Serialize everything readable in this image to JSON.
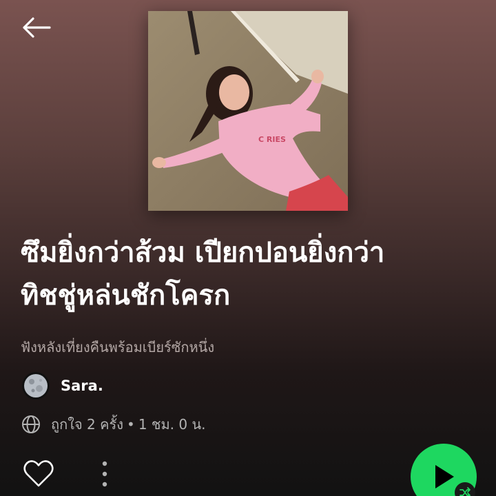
{
  "header": {
    "back_icon": "arrow-left-icon"
  },
  "playlist": {
    "cover_description_icon": "playlist-cover-image",
    "title_line1": "ซึมยิ่งกว่าส้วม เปียกปอนยิ่งกว่า",
    "title_line2": "ทิชชู่หล่นชักโครก",
    "description": "ฟังหลังเที่ยงคืนพร้อมเบียร์ซักหนึ่ง",
    "owner": {
      "name": "Sara.",
      "avatar_icon": "moon-avatar"
    },
    "meta": {
      "visibility_icon": "globe-icon",
      "likes": "ถูกใจ 2 ครั้ง",
      "separator": "•",
      "duration": "1 ชม. 0 น."
    }
  },
  "actions": {
    "like_icon": "heart-outline-icon",
    "more_icon": "more-vertical-icon",
    "play_icon": "play-icon",
    "shuffle_icon": "shuffle-icon"
  },
  "colors": {
    "accent": "#1ed760",
    "background_top": "#7a5350",
    "background_bottom": "#121212",
    "secondary_text": "#b3b3b3"
  }
}
